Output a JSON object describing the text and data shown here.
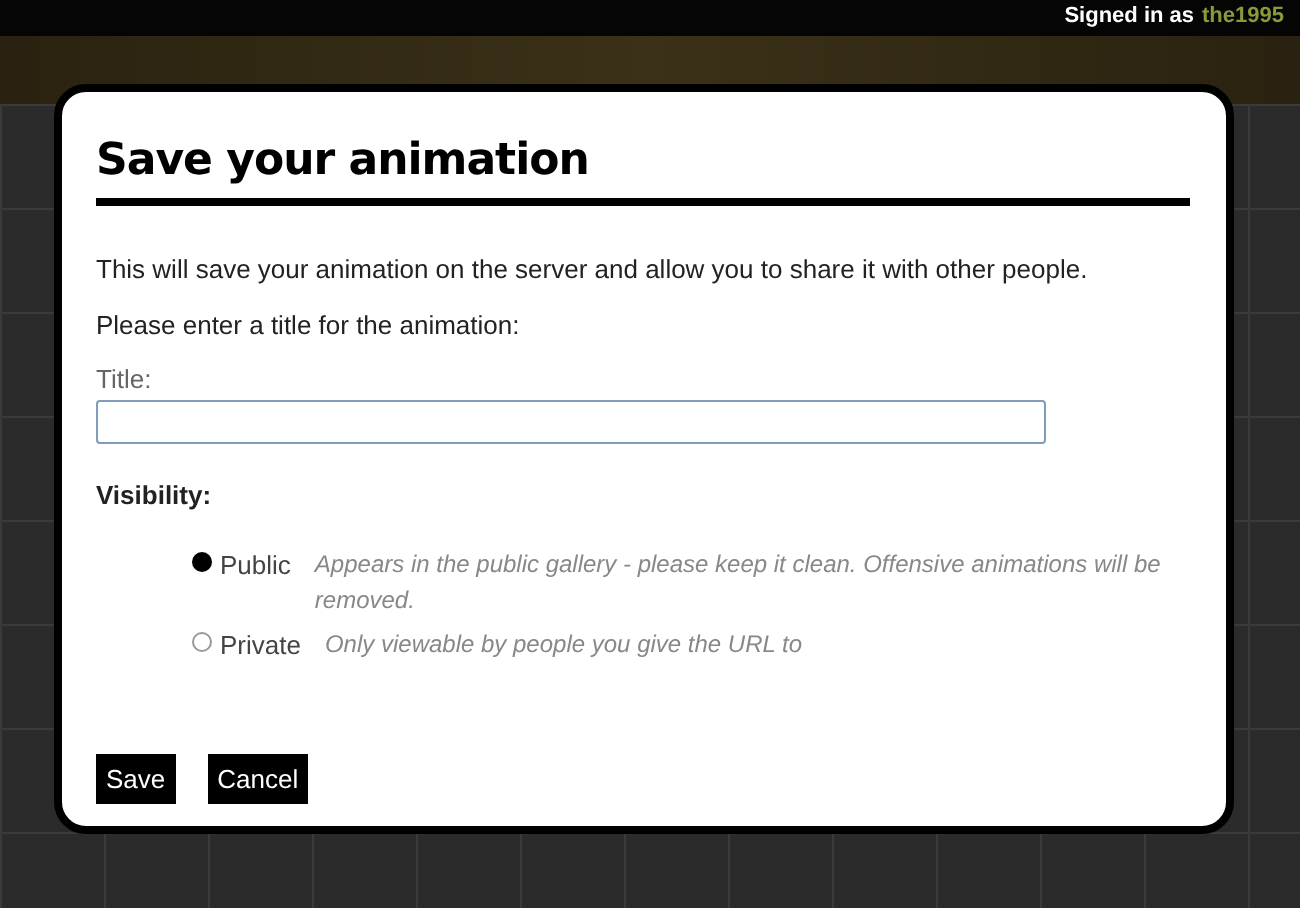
{
  "header": {
    "signed_in_label": "Signed in as",
    "username": "the1995"
  },
  "dialog": {
    "title": "Save your animation",
    "intro": "This will save your animation on the server and allow you to share it with other people.",
    "prompt": "Please enter a title for the animation:",
    "title_field": {
      "label": "Title:"
    },
    "visibility": {
      "label": "Visibility:",
      "options": [
        {
          "label": "Public",
          "description": "Appears in the public gallery - please keep it clean. Offensive animations will be removed.",
          "selected": true
        },
        {
          "label": "Private",
          "description": "Only viewable by people you give the URL to",
          "selected": false
        }
      ]
    },
    "buttons": [
      "Save",
      "Cancel"
    ]
  }
}
